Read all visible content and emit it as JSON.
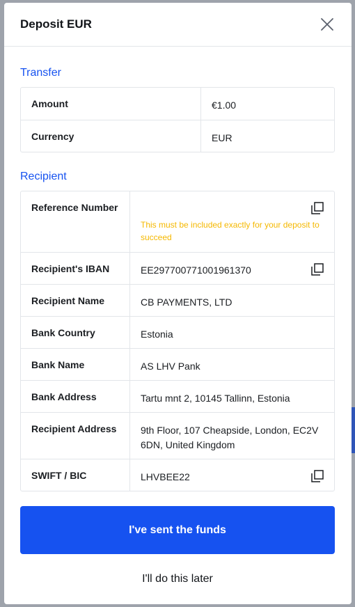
{
  "modal": {
    "title": "Deposit EUR"
  },
  "transfer": {
    "section_title": "Transfer",
    "rows": [
      {
        "label": "Amount",
        "value": "€1.00"
      },
      {
        "label": "Currency",
        "value": "EUR"
      }
    ]
  },
  "recipient": {
    "section_title": "Recipient",
    "reference": {
      "label": "Reference Number",
      "value": "",
      "note": "This must be included exactly for your deposit to succeed"
    },
    "iban": {
      "label": "Recipient's IBAN",
      "value": "EE297700771001961370"
    },
    "name": {
      "label": "Recipient Name",
      "value": "CB PAYMENTS, LTD"
    },
    "bank_country": {
      "label": "Bank Country",
      "value": "Estonia"
    },
    "bank_name": {
      "label": "Bank Name",
      "value": "AS LHV Pank"
    },
    "bank_address": {
      "label": "Bank Address",
      "value": "Tartu mnt 2, 10145 Tallinn, Estonia"
    },
    "recipient_address": {
      "label": "Recipient Address",
      "value": "9th Floor, 107 Cheapside, London, EC2V 6DN, United Kingdom"
    },
    "swift": {
      "label": "SWIFT / BIC",
      "value": "LHVBEE22"
    }
  },
  "actions": {
    "primary_label": "I've sent the funds",
    "secondary_label": "I'll do this later"
  },
  "icons": {
    "close": "close-icon",
    "copy": "copy-icon"
  },
  "colors": {
    "accent": "#1652f0",
    "warning": "#f5b800",
    "border": "#e2e5e9",
    "text": "#111418"
  }
}
